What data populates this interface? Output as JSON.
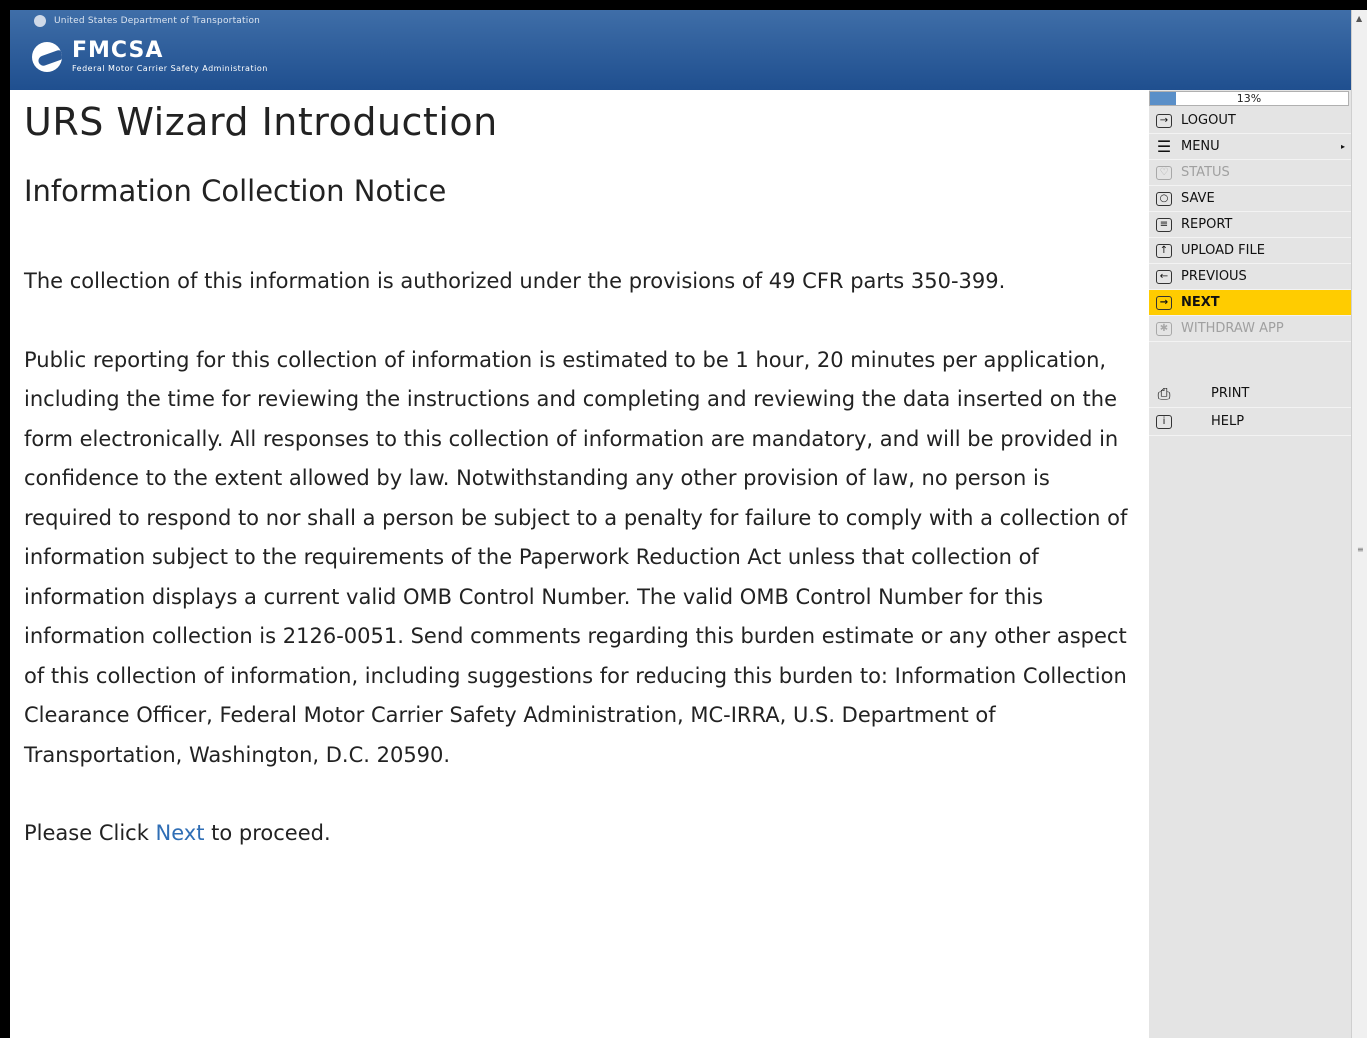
{
  "header": {
    "dot_text": "United States Department of Transportation",
    "brand_name": "FMCSA",
    "brand_sub": "Federal Motor Carrier Safety Administration"
  },
  "main": {
    "title": "URS Wizard Introduction",
    "subtitle": "Information Collection Notice",
    "para1": "The collection of this information is authorized under the provisions of 49 CFR parts 350-399.",
    "para2": "Public reporting for this collection of information is estimated to be 1 hour, 20 minutes per application, including the time for reviewing the instructions and completing and reviewing the data inserted on the form electronically. All responses to this collection of information are mandatory, and will be provided in confidence to the extent allowed by law. Notwithstanding any other provision of law, no person is required to respond to nor shall a person be subject to a penalty for failure to comply with a collection of information subject to the requirements of the Paperwork Reduction Act unless that collection of information displays a current valid OMB Control Number. The valid OMB Control Number for this information collection is 2126-0051. Send comments regarding this burden estimate or any other aspect of this collection of information, including suggestions for reducing this burden to: Information Collection Clearance Officer, Federal Motor Carrier Safety Administration, MC-IRRA, U.S. Department of Transportation, Washington, D.C. 20590.",
    "para3_before": "Please Click ",
    "para3_link": "Next",
    "para3_after": " to proceed."
  },
  "sidebar": {
    "progress_text": "13%",
    "progress_value": 0.13,
    "items": [
      {
        "label": "LOGOUT",
        "icon": "logout-icon"
      },
      {
        "label": "MENU",
        "icon": "menu-icon"
      },
      {
        "label": "STATUS",
        "icon": "status-icon"
      },
      {
        "label": "SAVE",
        "icon": "save-icon"
      },
      {
        "label": "REPORT",
        "icon": "report-icon"
      },
      {
        "label": "UPLOAD FILE",
        "icon": "upload-icon"
      },
      {
        "label": "PREVIOUS",
        "icon": "previous-icon"
      },
      {
        "label": "NEXT",
        "icon": "next-icon"
      },
      {
        "label": "WITHDRAW APP",
        "icon": "withdraw-icon"
      },
      {
        "label": "PRINT",
        "icon": "print-icon"
      },
      {
        "label": "HELP",
        "icon": "help-icon"
      }
    ],
    "active_color": "#ffcc00"
  },
  "colors": {
    "header": "#2b5a98",
    "link": "#2f6eb5"
  }
}
